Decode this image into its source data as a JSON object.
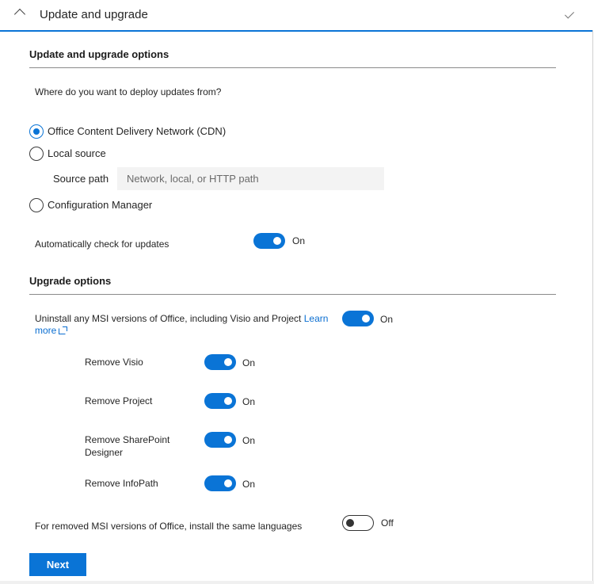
{
  "header": {
    "title": "Update and upgrade"
  },
  "update_section": {
    "title": "Update and upgrade options",
    "question": "Where do you want to deploy updates from?",
    "options": [
      {
        "label": "Office Content Delivery Network (CDN)",
        "selected": true
      },
      {
        "label": "Local source",
        "selected": false
      },
      {
        "label": "Configuration Manager",
        "selected": false
      }
    ],
    "source_path": {
      "label": "Source path",
      "placeholder": "Network, local, or HTTP path",
      "value": ""
    },
    "auto_check": {
      "label": "Automatically check for updates",
      "state": "On"
    }
  },
  "upgrade_section": {
    "title": "Upgrade options",
    "uninstall_msi": {
      "label": "Uninstall any MSI versions of Office, including Visio and Project",
      "link_part1": "Learn",
      "link_part2": "more",
      "state": "On"
    },
    "remove_items": [
      {
        "label": "Remove Visio",
        "state": "On"
      },
      {
        "label": "Remove Project",
        "state": "On"
      },
      {
        "label_line1": "Remove SharePoint",
        "label_line2": "Designer",
        "state": "On"
      },
      {
        "label": "Remove InfoPath",
        "state": "On"
      }
    ],
    "same_languages": {
      "label": "For removed MSI versions of Office, install the same languages",
      "state": "Off"
    }
  },
  "actions": {
    "next_label": "Next"
  }
}
